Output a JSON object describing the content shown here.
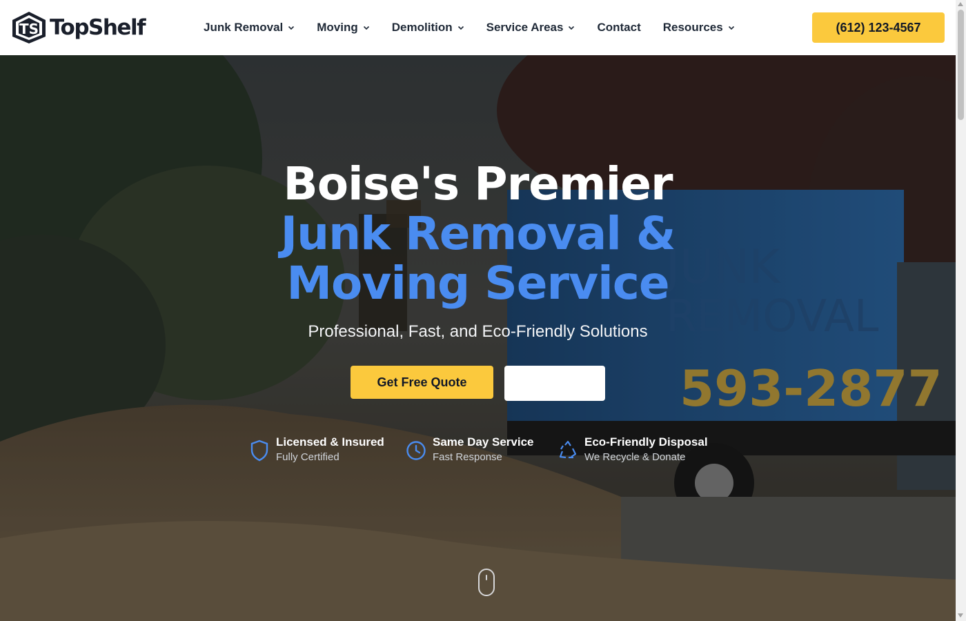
{
  "brand": {
    "name": "TopShelf",
    "logo_letters": "TS"
  },
  "nav": {
    "items": [
      {
        "label": "Junk Removal",
        "has_dropdown": true
      },
      {
        "label": "Moving",
        "has_dropdown": true
      },
      {
        "label": "Demolition",
        "has_dropdown": true
      },
      {
        "label": "Service Areas",
        "has_dropdown": true
      },
      {
        "label": "Contact",
        "has_dropdown": false
      },
      {
        "label": "Resources",
        "has_dropdown": true
      }
    ],
    "phone": "(612) 123-4567"
  },
  "hero": {
    "title_line1": "Boise's Premier",
    "title_line2": "Junk Removal &",
    "title_line3": "Moving Service",
    "subtitle": "Professional, Fast, and Eco-Friendly Solutions",
    "cta_primary": "Get Free Quote",
    "cta_secondary": "",
    "truck_text_top": "JUNK",
    "truck_text_mid": "REMOVAL",
    "truck_phone": "593-2877",
    "features": [
      {
        "icon": "shield-icon",
        "title": "Licensed & Insured",
        "subtitle": "Fully Certified"
      },
      {
        "icon": "clock-icon",
        "title": "Same Day Service",
        "subtitle": "Fast Response"
      },
      {
        "icon": "recycle-icon",
        "title": "Eco-Friendly Disposal",
        "subtitle": "We Recycle & Donate"
      }
    ]
  },
  "colors": {
    "accent_yellow": "#fbc93d",
    "accent_blue": "#4a8cf0",
    "text_dark": "#1f2937"
  }
}
